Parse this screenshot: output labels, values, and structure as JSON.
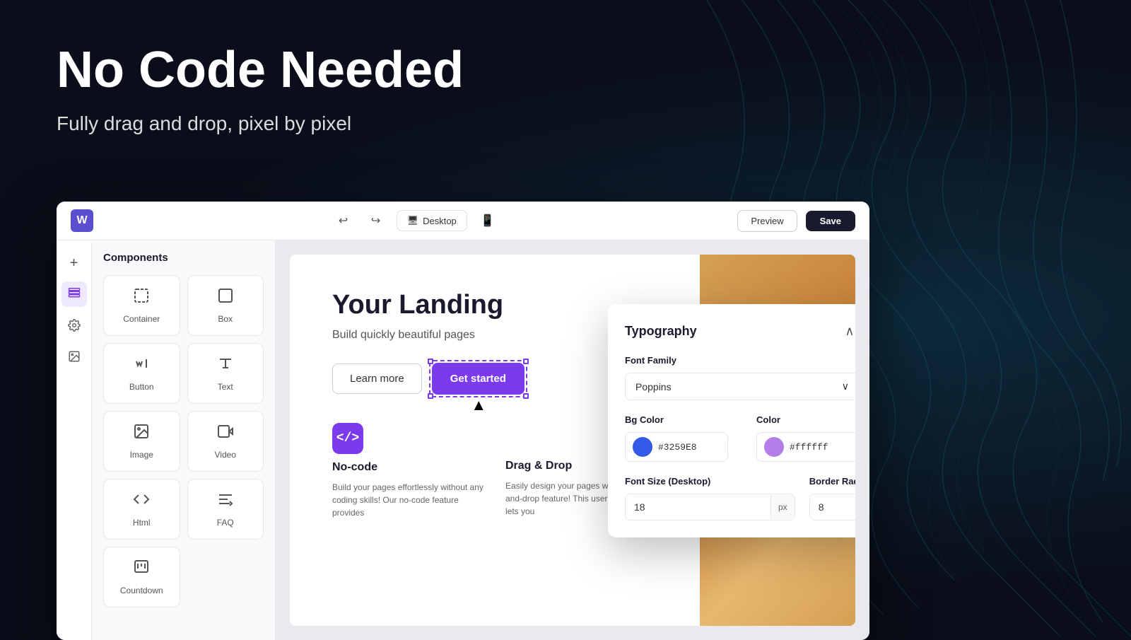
{
  "hero": {
    "title": "No Code Needed",
    "subtitle": "Fully drag and drop, pixel by pixel"
  },
  "topbar": {
    "logo": "W",
    "device_label": "Desktop",
    "preview_label": "Preview",
    "save_label": "Save"
  },
  "sidebar_icons": [
    {
      "name": "add-icon",
      "symbol": "+",
      "active": false
    },
    {
      "name": "layers-icon",
      "symbol": "⊞",
      "active": false
    },
    {
      "name": "settings-icon",
      "symbol": "⚙",
      "active": false
    },
    {
      "name": "media-icon",
      "symbol": "🖼",
      "active": false
    }
  ],
  "components_panel": {
    "title": "Components",
    "items": [
      {
        "label": "Container",
        "icon": "container"
      },
      {
        "label": "Box",
        "icon": "box"
      },
      {
        "label": "Button",
        "icon": "button"
      },
      {
        "label": "Text",
        "icon": "text"
      },
      {
        "label": "Image",
        "icon": "image"
      },
      {
        "label": "Video",
        "icon": "video"
      },
      {
        "label": "Html",
        "icon": "html"
      },
      {
        "label": "FAQ",
        "icon": "faq"
      },
      {
        "label": "Countdown",
        "icon": "countdown"
      }
    ]
  },
  "canvas": {
    "heading": "Your Landing",
    "subheading": "Build quickly beautiful pages",
    "buttons": {
      "learn_more": "Learn more",
      "get_started": "Get started"
    },
    "features": [
      {
        "icon": "</>",
        "title": "No-code",
        "desc": "Build your pages effortlessly without any coding skills! Our no-code feature provides"
      },
      {
        "icon": "⊞",
        "title": "Drag & Drop",
        "desc": "Easily design your pages with our drag-and-drop feature! This user-friendly tool lets you"
      }
    ]
  },
  "typography_panel": {
    "title": "Typography",
    "font_family_label": "Font Family",
    "font_family_value": "Poppins",
    "bg_color_label": "Bg Color",
    "bg_color_value": "#3259E8",
    "color_label": "Color",
    "color_value": "#ffffff",
    "font_size_label": "Font Size (Desktop)",
    "font_size_value": "18",
    "font_size_unit": "px",
    "border_radius_label": "Border Radius",
    "border_radius_value": "8"
  }
}
